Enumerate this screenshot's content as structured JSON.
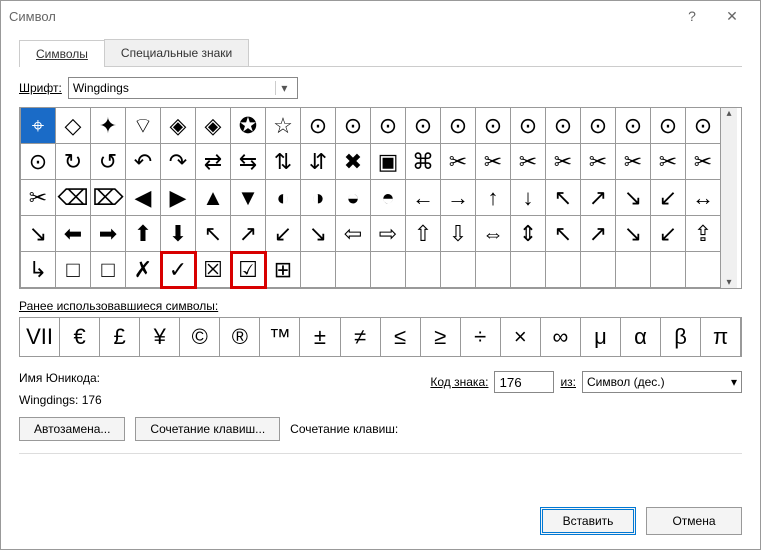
{
  "titlebar": {
    "title": "Символ"
  },
  "tabs": {
    "symbols": "Символы",
    "special": "Специальные знаки"
  },
  "font_row": {
    "label": "Шрифт:",
    "value": "Wingdings"
  },
  "grid": {
    "rows": [
      [
        "⌖",
        "◇",
        "✦",
        "⌔",
        "◈",
        "◈",
        "✪",
        "☆",
        "⊙",
        "⊙",
        "⊙",
        "⊙",
        "⊙",
        "⊙",
        "⊙",
        "⊙",
        "⊙",
        "⊙",
        "⊙",
        "⊙"
      ],
      [
        "⊙",
        "↻",
        "↺",
        "↶",
        "↷",
        "⇄",
        "⇆",
        "⇅",
        "⇵",
        "✖",
        "▣",
        "⌘",
        "✂",
        "✂",
        "✂",
        "✂",
        "✂",
        "✂",
        "✂",
        "✂"
      ],
      [
        "✂",
        "⌫",
        "⌦",
        "◀",
        "▶",
        "▲",
        "▼",
        "◐",
        "◑",
        "◒",
        "◓",
        "←",
        "→",
        "↑",
        "↓",
        "↖",
        "↗",
        "↘",
        "↙",
        "↔"
      ],
      [
        "↘",
        "⬅",
        "➡",
        "⬆",
        "⬇",
        "↖",
        "↗",
        "↙",
        "↘",
        "⇦",
        "⇨",
        "⇧",
        "⇩",
        "⇔",
        "⇕",
        "↖",
        "↗",
        "↘",
        "↙",
        "⇪"
      ],
      [
        "↳",
        "□",
        "□",
        "✗",
        "✓",
        "☒",
        "☑",
        "⊞",
        "",
        "",
        "",
        "",
        "",
        "",
        "",
        "",
        "",
        "",
        "",
        ""
      ]
    ],
    "selected": [
      0,
      0
    ],
    "highlighted": [
      [
        4,
        4
      ],
      [
        4,
        6
      ]
    ]
  },
  "prev": {
    "label": "Ранее использовавшиеся символы:",
    "items": [
      "VII",
      "€",
      "£",
      "¥",
      "©",
      "®",
      "™",
      "±",
      "≠",
      "≤",
      "≥",
      "÷",
      "×",
      "∞",
      "μ",
      "α",
      "β",
      "π"
    ]
  },
  "meta": {
    "unicode_name_label": "Имя Юникода:",
    "unicode_name_value": "Wingdings: 176",
    "code_label": "Код знака:",
    "code_value": "176",
    "from_label": "из:",
    "from_value": "Символ (дес.)"
  },
  "buttons": {
    "autocorrect": "Автозамена...",
    "shortcut": "Сочетание клавиш...",
    "shortcut_label": "Сочетание клавиш:",
    "insert": "Вставить",
    "cancel": "Отмена"
  }
}
